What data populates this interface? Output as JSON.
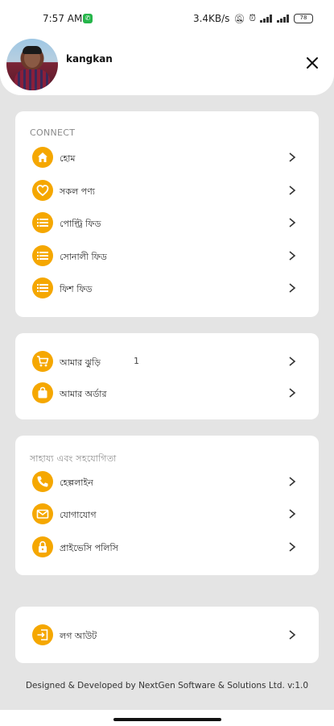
{
  "status_bar": {
    "time": "7:57 AM",
    "speed": "3.4KB/s",
    "battery": "78"
  },
  "profile": {
    "username": "kangkan"
  },
  "sections": {
    "connect": {
      "title": "CONNECT",
      "items": [
        {
          "label": "হোম",
          "icon": "home-icon"
        },
        {
          "label": "সকল পণ্য",
          "icon": "heart-icon"
        },
        {
          "label": "পোল্ট্রি ফিড",
          "icon": "list-icon"
        },
        {
          "label": "সোনালী ফিড",
          "icon": "list-icon"
        },
        {
          "label": "ফিশ ফিড",
          "icon": "list-icon"
        }
      ]
    },
    "orders": {
      "items": [
        {
          "label": "আমার ঝুড়ি",
          "count": "1",
          "icon": "cart-icon"
        },
        {
          "label": "আমার অর্ডার",
          "icon": "bag-icon"
        }
      ]
    },
    "support": {
      "title": "সাহায্য এবং সহযোগিতা",
      "items": [
        {
          "label": "হেল্পলাইন",
          "icon": "phone-icon"
        },
        {
          "label": "যোগাযোগ",
          "icon": "mail-icon"
        },
        {
          "label": "প্রাইভেসি পলিসি",
          "icon": "lock-icon"
        }
      ]
    },
    "logout": {
      "label": "লগ আউট",
      "icon": "logout-icon"
    }
  },
  "footer": {
    "text": "Designed & Developed by NextGen Software & Solutions Ltd. v:1.0"
  },
  "colors": {
    "accent": "#f5a700",
    "background": "#e4e4e4",
    "card": "#ffffff"
  }
}
